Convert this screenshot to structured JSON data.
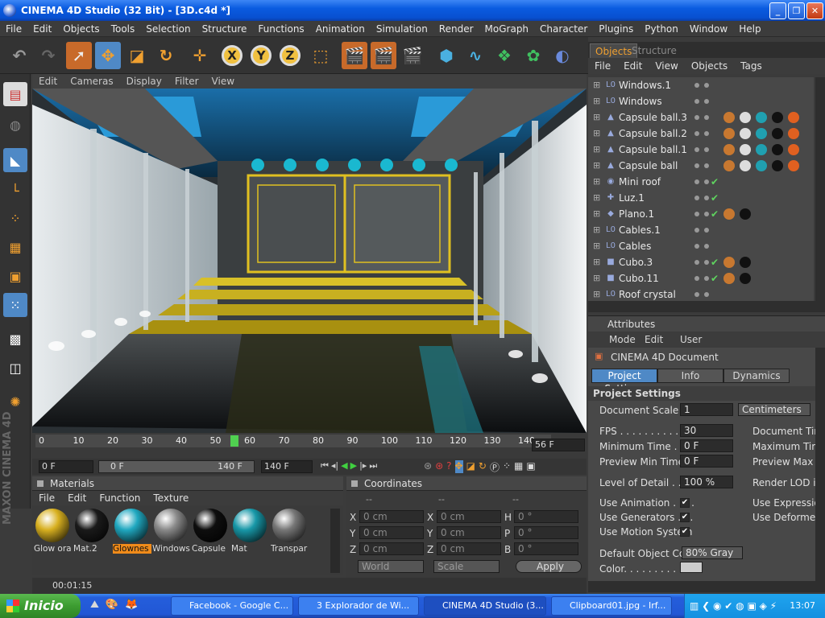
{
  "window": {
    "title": "CINEMA 4D Studio (32 Bit) - [3D.c4d *]"
  },
  "menubar": [
    "File",
    "Edit",
    "Objects",
    "Tools",
    "Selection",
    "Structure",
    "Functions",
    "Animation",
    "Simulation",
    "Render",
    "MoGraph",
    "Character",
    "Plugins",
    "Python",
    "Window",
    "Help"
  ],
  "viewport": {
    "menu": [
      "Edit",
      "Cameras",
      "Display",
      "Filter",
      "View"
    ]
  },
  "timeline": {
    "ticks": [
      "0",
      "10",
      "20",
      "30",
      "40",
      "50",
      "60",
      "70",
      "80",
      "90",
      "100",
      "110",
      "120",
      "130",
      "140"
    ],
    "current_marker": "56",
    "current_frame": "56 F"
  },
  "transport": {
    "start_field": "0 F",
    "range_start": "0 F",
    "range_end": "140 F",
    "end_field": "140 F"
  },
  "materials": {
    "header": "Materials",
    "menu": [
      "File",
      "Edit",
      "Function",
      "Texture"
    ],
    "items": [
      {
        "label": "Glow ora",
        "color": "#d8b020"
      },
      {
        "label": "Mat.2",
        "color": "#1a1a1a"
      },
      {
        "label": "Glownes",
        "color": "#20a8c0",
        "selected": true
      },
      {
        "label": "Windows",
        "color": "#8a8a8a"
      },
      {
        "label": "Capsule",
        "color": "#0e0e0e"
      },
      {
        "label": "Mat",
        "color": "#1898a8"
      },
      {
        "label": "Transpar",
        "color": "#777777"
      }
    ],
    "status_time": "00:01:15"
  },
  "coordinates": {
    "header": "Coordinates",
    "rows": [
      {
        "a": "X",
        "av": "0 cm",
        "b": "X",
        "bv": "0 cm",
        "c": "H",
        "cv": "0 °"
      },
      {
        "a": "Y",
        "av": "0 cm",
        "b": "Y",
        "bv": "0 cm",
        "c": "P",
        "cv": "0 °"
      },
      {
        "a": "Z",
        "av": "0 cm",
        "b": "Z",
        "bv": "0 cm",
        "c": "B",
        "cv": "0 °"
      }
    ],
    "world": "World",
    "scale": "Scale",
    "apply": "Apply",
    "dashes": [
      "--",
      "--",
      "--"
    ]
  },
  "objects": {
    "tabs": [
      "Objects",
      "Structure"
    ],
    "menu": [
      "File",
      "Edit",
      "View",
      "Objects",
      "Tags"
    ],
    "rows": [
      {
        "name": "Windows.1",
        "icon": "L0",
        "check": false,
        "tags": []
      },
      {
        "name": "Windows",
        "icon": "L0",
        "check": false,
        "tags": []
      },
      {
        "name": "Capsule ball.3",
        "icon": "▲",
        "check": false,
        "tags": [
          "#c87830",
          "#ddd",
          "#20a0b0",
          "#111",
          "#e06020"
        ]
      },
      {
        "name": "Capsule ball.2",
        "icon": "▲",
        "check": false,
        "tags": [
          "#c87830",
          "#ddd",
          "#20a0b0",
          "#111",
          "#e06020"
        ]
      },
      {
        "name": "Capsule ball.1",
        "icon": "▲",
        "check": false,
        "tags": [
          "#c87830",
          "#ddd",
          "#20a0b0",
          "#111",
          "#e06020"
        ]
      },
      {
        "name": "Capsule ball",
        "icon": "▲",
        "check": false,
        "tags": [
          "#c87830",
          "#ddd",
          "#20a0b0",
          "#111",
          "#e06020"
        ]
      },
      {
        "name": "Mini roof",
        "icon": "◉",
        "check": true,
        "tags": []
      },
      {
        "name": "Luz.1",
        "icon": "✚",
        "check": true,
        "tags": []
      },
      {
        "name": "Plano.1",
        "icon": "◆",
        "check": true,
        "tags": [
          "#c87830",
          "#111"
        ]
      },
      {
        "name": "Cables.1",
        "icon": "L0",
        "check": false,
        "tags": []
      },
      {
        "name": "Cables",
        "icon": "L0",
        "check": false,
        "tags": []
      },
      {
        "name": "Cubo.3",
        "icon": "■",
        "check": true,
        "tags": [
          "#c87830",
          "#111"
        ]
      },
      {
        "name": "Cubo.11",
        "icon": "■",
        "check": true,
        "tags": [
          "#c87830",
          "#111"
        ]
      },
      {
        "name": "Roof crystal",
        "icon": "L0",
        "check": false,
        "tags": []
      }
    ]
  },
  "attributes": {
    "header": "Attributes",
    "menu": [
      "Mode",
      "Edit",
      "User"
    ],
    "doc": "CINEMA 4D Document",
    "tabs": [
      "Project Settings",
      "Info",
      "Dynamics"
    ],
    "section": "Project Settings",
    "doc_scale_label": "Document Scale . .",
    "doc_scale": "1",
    "doc_units": "Centimeters",
    "fps_label": "FPS . . . . . . . . . . . .",
    "fps": "30",
    "doc_time_label": "Document Time",
    "min_time_label": "Minimum Time . . . .",
    "min_time": "0 F",
    "max_time_label": "Maximum Time",
    "prev_min_label": "Preview Min Time. .",
    "prev_min": "0 F",
    "prev_max_label": "Preview Max T",
    "lod_label": "Level of Detail . . . .",
    "lod": "100 %",
    "render_lod_label": "Render LOD in",
    "use_anim": "Use Animation . . . .",
    "use_expr": "Use Expression",
    "use_gen": "Use Generators . . .",
    "use_def": "Use Deformers",
    "use_motion": "Use Motion System",
    "def_color_label": "Default Object Color",
    "def_color": "80% Gray",
    "color_label": "Color. . . . . . . . ."
  },
  "taskbar": {
    "start": "Inicio",
    "tasks": [
      "Facebook - Google C...",
      "3 Explorador de Wi...",
      "CINEMA 4D Studio (3...",
      "Clipboard01.jpg - Irf..."
    ],
    "clock": "13:07"
  },
  "maxon": "MAXON CINEMA 4D"
}
